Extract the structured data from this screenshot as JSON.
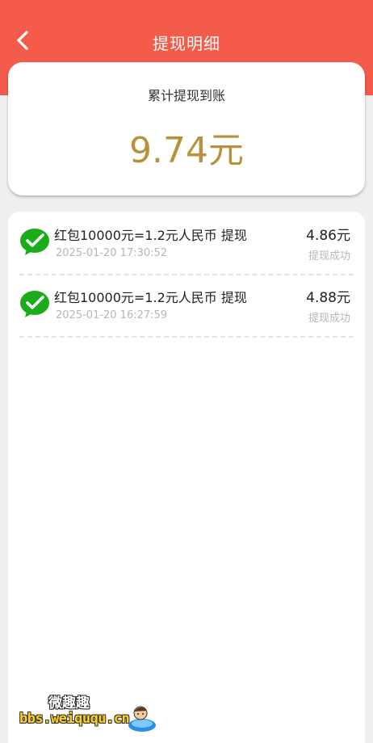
{
  "header": {
    "title": "提现明细",
    "back_icon": "chevron-left-icon"
  },
  "summary": {
    "label": "累计提现到账",
    "amount": "9.74元"
  },
  "records": [
    {
      "title": "红包10000元=1.2元人民币 提现",
      "time": "2025-01-20 17:30:52",
      "amount": "4.86元",
      "status": "提现成功",
      "icon": "wechat-pay-icon"
    },
    {
      "title": "红包10000元=1.2元人民币 提现",
      "time": "2025-01-20 16:27:59",
      "amount": "4.88元",
      "status": "提现成功",
      "icon": "wechat-pay-icon"
    }
  ],
  "watermark": {
    "text": "微趣趣",
    "url": "bbs.weiququ.cn"
  },
  "colors": {
    "header": "#f45b4b",
    "amount_gold": "#b8913c",
    "wechat_green": "#1aad19"
  }
}
